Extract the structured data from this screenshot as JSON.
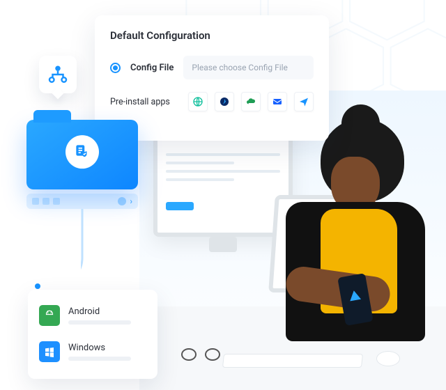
{
  "config": {
    "title": "Default Configuration",
    "radio_label": "Config File",
    "file_placeholder": "Please choose Config File",
    "preinstall_label": "Pre-install apps",
    "apps": [
      {
        "name": "globe-app",
        "color": "#0fbf9c"
      },
      {
        "name": "compass-app",
        "color": "#0a2a66"
      },
      {
        "name": "cloud-app",
        "color": "#1f9d55"
      },
      {
        "name": "mail-app",
        "color": "#1660ff"
      },
      {
        "name": "send-app",
        "color": "#1893ff"
      }
    ]
  },
  "os_list": [
    {
      "name": "Android"
    },
    {
      "name": "Windows"
    }
  ],
  "colors": {
    "accent": "#1893ff"
  }
}
